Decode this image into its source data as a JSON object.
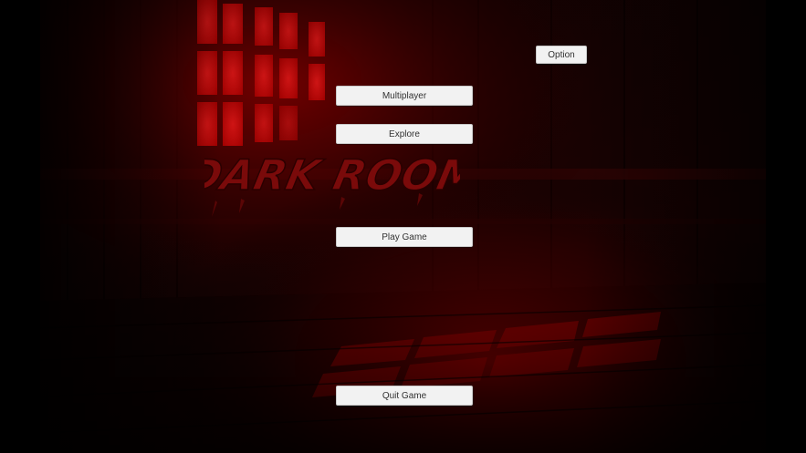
{
  "game": {
    "title": "DARK ROOM"
  },
  "menu": {
    "option_label": "Option",
    "multiplayer_label": "Multiplayer",
    "explore_label": "Explore",
    "play_label": "Play Game",
    "quit_label": "Quit Game"
  },
  "colors": {
    "accent_red": "#d40000",
    "logo_red": "#7a0a0a",
    "button_bg": "#f2f2f2",
    "button_text": "#323232"
  }
}
